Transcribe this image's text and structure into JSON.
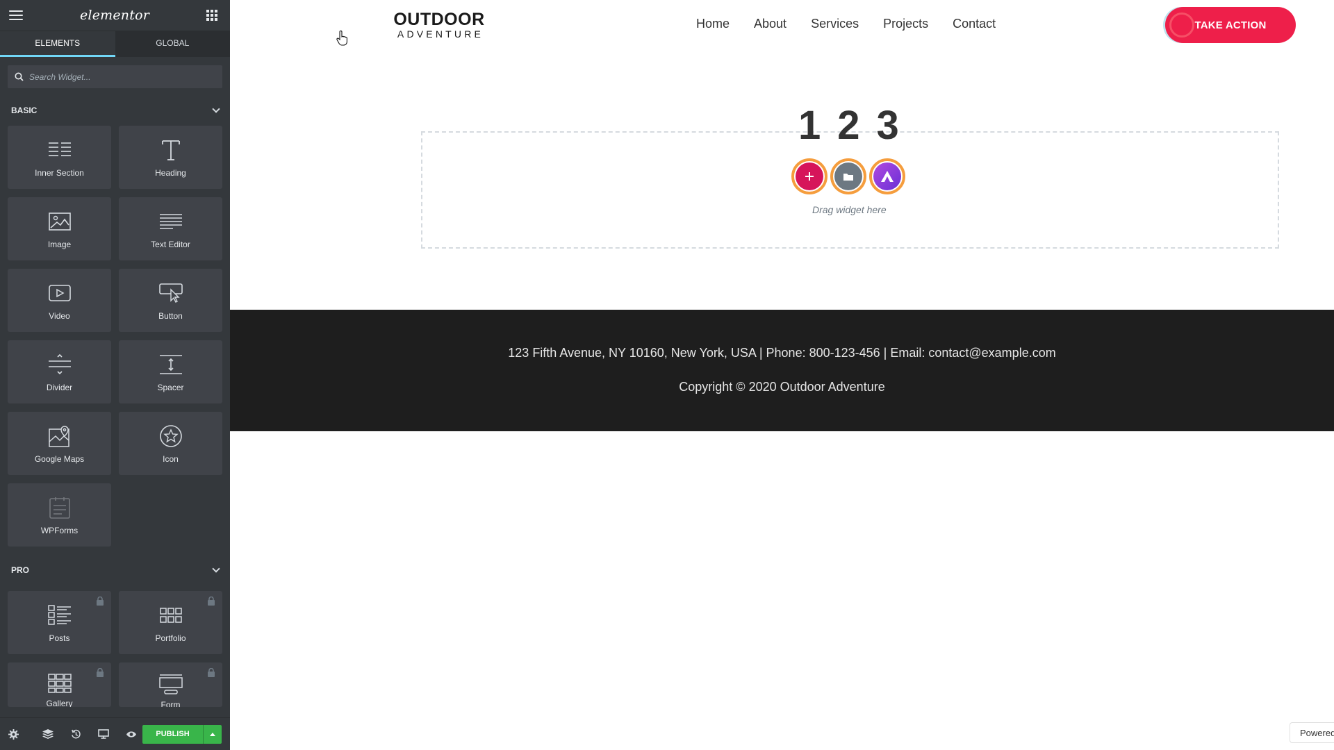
{
  "sidebar": {
    "logo": "elementor",
    "tabs": [
      {
        "label": "ELEMENTS"
      },
      {
        "label": "GLOBAL"
      }
    ],
    "search": {
      "placeholder": "Search Widget..."
    },
    "categories": [
      {
        "label": "BASIC"
      },
      {
        "label": "PRO"
      }
    ],
    "basic_widgets": [
      {
        "label": "Inner Section",
        "icon": "inner-section-icon"
      },
      {
        "label": "Heading",
        "icon": "heading-icon"
      },
      {
        "label": "Image",
        "icon": "image-icon"
      },
      {
        "label": "Text Editor",
        "icon": "text-editor-icon"
      },
      {
        "label": "Video",
        "icon": "video-icon"
      },
      {
        "label": "Button",
        "icon": "button-icon"
      },
      {
        "label": "Divider",
        "icon": "divider-icon"
      },
      {
        "label": "Spacer",
        "icon": "spacer-icon"
      },
      {
        "label": "Google Maps",
        "icon": "google-maps-icon"
      },
      {
        "label": "Icon",
        "icon": "star-icon"
      },
      {
        "label": "WPForms",
        "icon": "wpforms-icon"
      }
    ],
    "pro_widgets": [
      {
        "label": "Posts",
        "icon": "posts-icon",
        "locked": true
      },
      {
        "label": "Portfolio",
        "icon": "portfolio-icon",
        "locked": true
      },
      {
        "label": "Gallery",
        "icon": "gallery-icon",
        "locked": true
      },
      {
        "label": "Form",
        "icon": "form-icon",
        "locked": true
      }
    ],
    "footer": {
      "publish_label": "PUBLISH",
      "icons": [
        "settings-icon",
        "navigator-icon",
        "history-icon",
        "responsive-icon",
        "preview-eye-icon"
      ]
    }
  },
  "site": {
    "brand_line1": "OUTDOOR",
    "brand_line2": "ADVENTURE",
    "nav": [
      {
        "label": "Home"
      },
      {
        "label": "About"
      },
      {
        "label": "Services"
      },
      {
        "label": "Projects"
      },
      {
        "label": "Contact"
      }
    ],
    "cta_label": "TAKE ACTION",
    "cta_color": "#ee1f4a"
  },
  "dropzone": {
    "numbers": [
      "1",
      "2",
      "3"
    ],
    "hint": "Drag widget here",
    "button_colors": [
      "#d6155a",
      "#6d7882",
      "#8a3ad6"
    ]
  },
  "footer": {
    "address": "123 Fifth Avenue, NY 10160, New York, USA | Phone: 800-123-456 | Email: contact@example.com",
    "copyright": "Copyright © 2020 Outdoor Adventure"
  },
  "powered_label": "Powered"
}
